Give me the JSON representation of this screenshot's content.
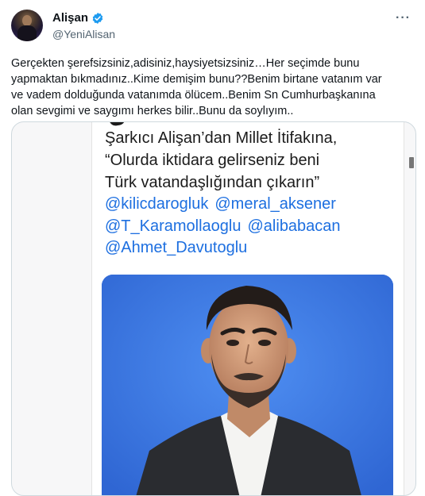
{
  "author": {
    "display_name": "Alişan",
    "handle": "@YeniAlisan",
    "verified": true,
    "verified_color": "#1d9bf0"
  },
  "tweet": {
    "text": "Gerçekten şerefsizsiniz,adisiniz,haysiyetsizsiniz…Her seçimde bunu\nyapmaktan bıkmadınız..Kime demişim bunu??Benim birtane vatanım var\nve vadem dolduğunda vatanımda ölücem..Benim Sn Cumhurbaşkanına\nolan sevgimi ve saygımı herkes bilir..Bunu da soylıyım.."
  },
  "media": {
    "headline": "Şarkıcı Alişan’dan Millet İtifakına,\n“Olurda iktidara gelirseniz beni\nTürk vatandaşlığından çıkarın”",
    "mentions": [
      "@kilicdarogluk",
      "@meral_aksener",
      "@T_Karamollaoglu",
      "@alibabacan",
      "@Ahmet_Davutoglu"
    ],
    "mention_color": "#1d6fe0",
    "photo_background": "#3a78e3"
  },
  "icons": {
    "more": "more-options-icon",
    "verified": "verified-badge-icon"
  }
}
